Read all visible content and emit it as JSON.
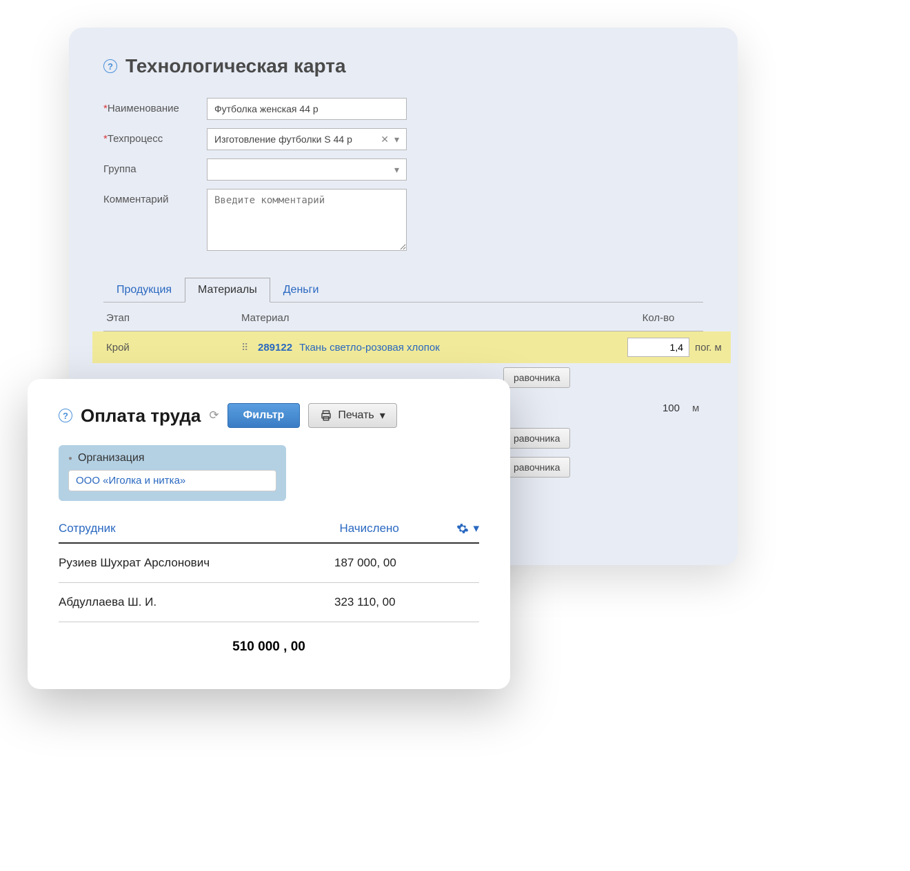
{
  "techCard": {
    "title": "Технологическая карта",
    "fields": {
      "name_label": "Наименование",
      "name_value": "Футболка женская 44 р",
      "process_label": "Техпроцесс",
      "process_value": "Изготовление футболки S 44 р",
      "group_label": "Группа",
      "group_value": "",
      "comment_label": "Комментарий",
      "comment_placeholder": "Введите комментарий"
    },
    "tabs": {
      "products": "Продукция",
      "materials": "Материалы",
      "money": "Деньги"
    },
    "grid": {
      "col_stage": "Этап",
      "col_material": "Материал",
      "col_qty": "Кол-во",
      "row1_stage": "Крой",
      "row1_code": "289122",
      "row1_material": "Ткань светло-розовая хлопок",
      "row1_qty": "1,4",
      "row1_unit": "пог. м",
      "ref_btn": "равочника",
      "row2_qty": "100",
      "row2_unit": "м"
    }
  },
  "payroll": {
    "title": "Оплата труда",
    "filter_btn": "Фильтр",
    "print_btn": "Печать",
    "org_label": "Организация",
    "org_value": "ООО «Иголка и нитка»",
    "col_employee": "Сотрудник",
    "col_accrued": "Начислено",
    "rows": [
      {
        "name": "Рузиев Шухрат Арслонович",
        "amount": "187 000, 00"
      },
      {
        "name": "Абдуллаева Ш. И.",
        "amount": "323 110, 00"
      }
    ],
    "total": "510 000 , 00"
  }
}
